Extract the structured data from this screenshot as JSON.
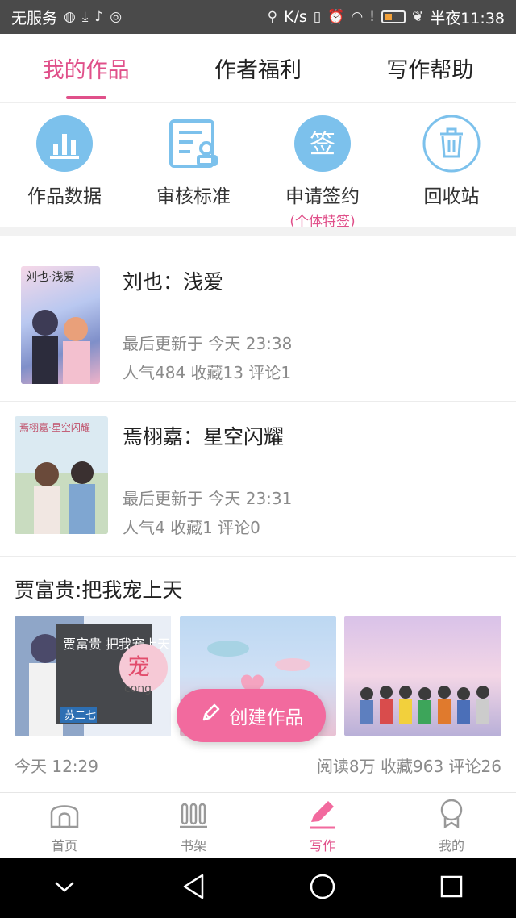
{
  "status_bar": {
    "carrier": "无服务",
    "speed": "K/s",
    "time": "半夜11:38"
  },
  "top_tabs": [
    {
      "label": "我的作品",
      "active": true
    },
    {
      "label": "作者福利",
      "active": false
    },
    {
      "label": "写作帮助",
      "active": false
    }
  ],
  "quick_actions": [
    {
      "label": "作品数据",
      "icon": "bar-chart-icon"
    },
    {
      "label": "审核标准",
      "icon": "review-standard-icon"
    },
    {
      "label": "申请签约",
      "sub": "(个体特签)",
      "icon": "sign-contract-icon",
      "icon_text": "签"
    },
    {
      "label": "回收站",
      "icon": "trash-icon"
    }
  ],
  "works": [
    {
      "title": "刘也：浅爱",
      "updated": "最后更新于 今天 23:38",
      "stats": "人气484 收藏13 评论1",
      "cover_text": "刘也·浅爱"
    },
    {
      "title": "焉栩嘉：星空闪耀",
      "updated": "最后更新于 今天 23:31",
      "stats": "人气4 收藏1 评论0",
      "cover_text": "焉栩嘉·星空闪耀"
    }
  ],
  "featured": {
    "title": "贾富贵:把我宠上天",
    "date": "今天 12:29",
    "stats": "阅读8万 收藏963 评论26",
    "thumb1_text": "贾富贵 把我宠上天",
    "thumb1_author": "苏二七",
    "thumb1_big": "宠",
    "thumb1_small": "cong"
  },
  "create_button": {
    "label": "创建作品"
  },
  "bottom_nav": [
    {
      "label": "首页",
      "icon": "home-icon",
      "active": false
    },
    {
      "label": "书架",
      "icon": "bookshelf-icon",
      "active": false
    },
    {
      "label": "写作",
      "icon": "pen-icon",
      "active": true
    },
    {
      "label": "我的",
      "icon": "profile-icon",
      "active": false
    }
  ],
  "colors": {
    "accent": "#e0508a",
    "button": "#f26a9e",
    "icon_blue": "#7cc1ec"
  }
}
